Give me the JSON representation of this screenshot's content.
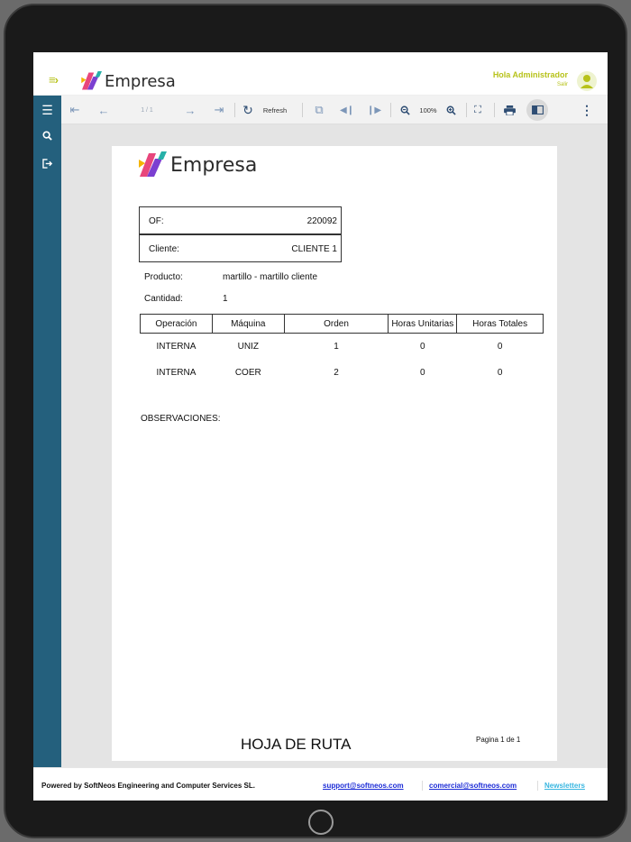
{
  "app": {
    "brand": "Empresa",
    "menu_glyph": "≡›"
  },
  "user": {
    "greeting": "Hola Administrador",
    "subtitle": "Salir"
  },
  "toolbar": {
    "page_indicator": "1 / 1",
    "refresh_label": "Refresh",
    "zoom_level": "100%"
  },
  "report": {
    "of_label": "OF:",
    "of_value": "220092",
    "cliente_label": "Cliente:",
    "cliente_value": "CLIENTE 1",
    "producto_label": "Producto:",
    "producto_value": "martillo - martillo cliente",
    "cantidad_label": "Cantidad:",
    "cantidad_value": "1",
    "columns": [
      "Operación",
      "Máquina",
      "Orden",
      "Horas Unitarias",
      "Horas Totales"
    ],
    "rows": [
      [
        "INTERNA",
        "UNIZ",
        "1",
        "0",
        "0"
      ],
      [
        "INTERNA",
        "COER",
        "2",
        "0",
        "0"
      ]
    ],
    "observaciones_label": "OBSERVACIONES:",
    "title": "HOJA DE RUTA",
    "page_number": "Pagina 1 de 1"
  },
  "footer": {
    "powered_by": "Powered by SoftNeos Engineering and Computer Services SL.",
    "support_email": "support@softneos.com",
    "commercial_email": "comercial@softneos.com",
    "newsletters": "Newsletters"
  },
  "colors": {
    "accent": "#b7c21a",
    "sidebar": "#24607d",
    "link": "#1b2bd6",
    "newsletter": "#38b6e0"
  },
  "icons": [
    "menu-icon",
    "search-icon",
    "logout-icon",
    "first-page-icon",
    "prev-page-icon",
    "next-page-icon",
    "last-page-icon",
    "refresh-icon",
    "export-icon",
    "prev-section-icon",
    "next-section-icon",
    "zoom-out-icon",
    "zoom-in-icon",
    "fullscreen-icon",
    "print-icon",
    "panel-icon",
    "more-icon",
    "user-avatar-icon"
  ]
}
